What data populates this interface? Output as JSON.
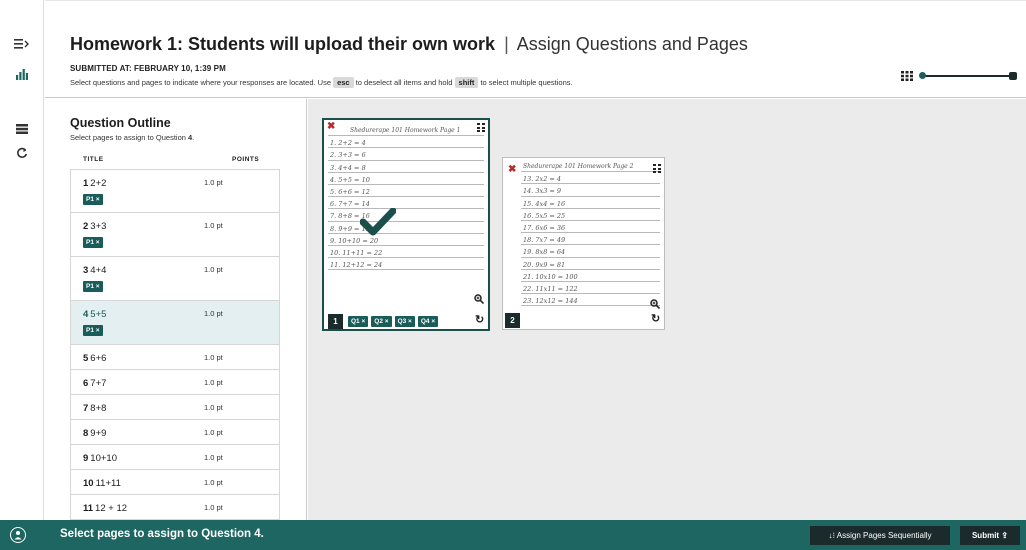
{
  "header": {
    "assignment_title": "Homework 1: Students will upload their own work",
    "separator": "|",
    "subtitle": "Assign Questions and Pages",
    "submitted": "SUBMITTED AT: FEBRUARY 10, 1:39 PM",
    "instr_part1": "Select questions and pages to indicate where your responses are located. Use",
    "key_esc": "esc",
    "instr_part2": "to deselect all items and hold",
    "key_shift": "shift",
    "instr_part3": "to select multiple questions.",
    "zoom_level": 1.0
  },
  "outline": {
    "heading": "Question Outline",
    "hint_prefix": "Select pages to assign to Question",
    "hint_number": "4",
    "hint_suffix": ".",
    "col_title": "TITLE",
    "col_points": "POINTS",
    "questions": [
      {
        "num": "1",
        "title": "2+2",
        "points": "1.0 pt",
        "tag": "P1 ×"
      },
      {
        "num": "2",
        "title": "3+3",
        "points": "1.0 pt",
        "tag": "P1 ×"
      },
      {
        "num": "3",
        "title": "4+4",
        "points": "1.0 pt",
        "tag": "P1 ×"
      },
      {
        "num": "4",
        "title": "5+5",
        "points": "1.0 pt",
        "tag": "P1 ×"
      },
      {
        "num": "5",
        "title": "6+6",
        "points": "1.0 pt"
      },
      {
        "num": "6",
        "title": "7+7",
        "points": "1.0 pt"
      },
      {
        "num": "7",
        "title": "8+8",
        "points": "1.0 pt"
      },
      {
        "num": "8",
        "title": "9+9",
        "points": "1.0 pt"
      },
      {
        "num": "9",
        "title": "10+10",
        "points": "1.0 pt"
      },
      {
        "num": "10",
        "title": "11+11",
        "points": "1.0 pt"
      },
      {
        "num": "11",
        "title": "12 + 12",
        "points": "1.0 pt"
      }
    ]
  },
  "pages": [
    {
      "number": "1",
      "selected": true,
      "header": "Shedurerape 101 Homework Page 1",
      "lines": [
        "1. 2+2 = 4",
        "2. 3+3 = 6",
        "3. 4+4 = 8",
        "4. 5+5 = 10",
        "5. 6+6 = 12",
        "6. 7+7 = 14",
        "7. 8+8 = 16",
        "8. 9+9 = 18",
        "9. 10+10 = 20",
        "10. 11+11 = 22",
        "11. 12+12 = 24"
      ],
      "chips": [
        "Q1 ×",
        "Q2 ×",
        "Q3 ×",
        "Q4 ×"
      ]
    },
    {
      "number": "2",
      "selected": false,
      "header": "Shedurerape 101 Homework Page 2",
      "lines": [
        "13. 2x2 = 4",
        "14. 3x3 = 9",
        "15. 4x4 = 16",
        "16. 5x5 = 25",
        "17. 6x6 = 36",
        "18. 7x7 = 49",
        "19. 8x8 = 64",
        "20. 9x9 = 81",
        "21. 10x10 = 100",
        "22. 11x11 = 122",
        "23. 12x12 = 144"
      ],
      "chips": []
    }
  ],
  "footer": {
    "message": "Select pages to assign to Question 4.",
    "sequential_button": "Assign Pages Sequentially",
    "submit_button": "Submit"
  },
  "colors": {
    "accent": "#1d6661",
    "tag": "#1a5c5a",
    "dark_button": "#1b2b2b",
    "selected_row": "#e3eff0",
    "remove_x": "#b52c2c"
  }
}
